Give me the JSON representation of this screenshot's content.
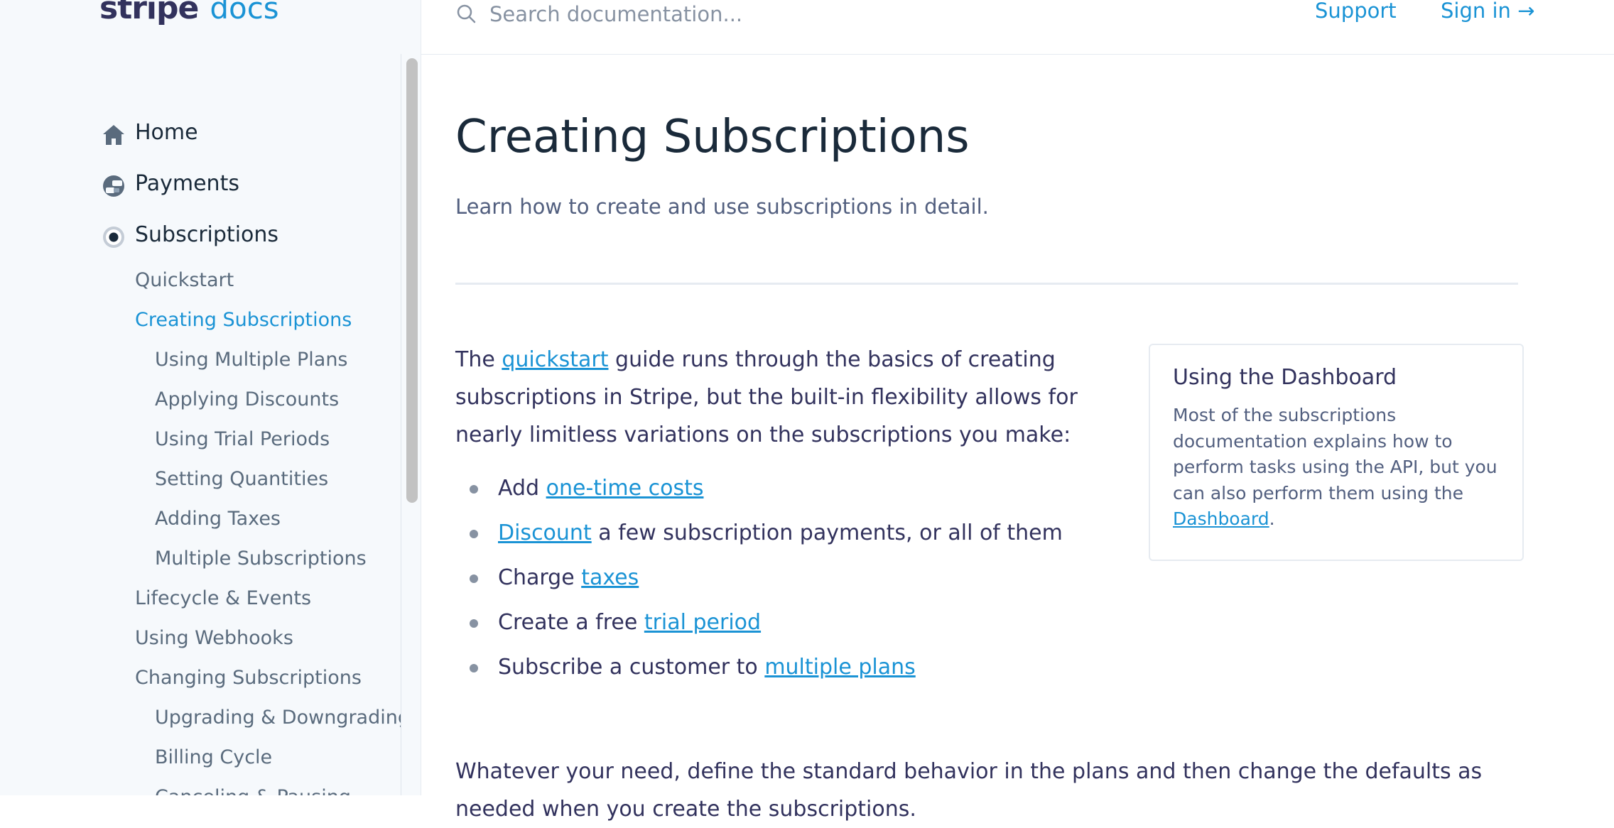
{
  "logo": {
    "brand": "stripe",
    "suffix": "docs"
  },
  "header": {
    "search_placeholder": "Search documentation...",
    "support_label": "Support",
    "signin_label": "Sign in →"
  },
  "sidebar": {
    "top_items": [
      {
        "label": "Home",
        "icon": "home-icon"
      },
      {
        "label": "Payments",
        "icon": "payments-icon"
      },
      {
        "label": "Subscriptions",
        "icon": "subscriptions-icon"
      }
    ],
    "sub_items": [
      {
        "label": "Quickstart",
        "level": 1
      },
      {
        "label": "Creating Subscriptions",
        "level": 1,
        "active": true
      },
      {
        "label": "Using Multiple Plans",
        "level": 2
      },
      {
        "label": "Applying Discounts",
        "level": 2
      },
      {
        "label": "Using Trial Periods",
        "level": 2
      },
      {
        "label": "Setting Quantities",
        "level": 2
      },
      {
        "label": "Adding Taxes",
        "level": 2
      },
      {
        "label": "Multiple Subscriptions",
        "level": 2
      },
      {
        "label": "Lifecycle & Events",
        "level": 1
      },
      {
        "label": "Using Webhooks",
        "level": 1
      },
      {
        "label": "Changing Subscriptions",
        "level": 1
      },
      {
        "label": "Upgrading & Downgrading",
        "level": 2
      },
      {
        "label": "Billing Cycle",
        "level": 2
      },
      {
        "label": "Canceling & Pausing",
        "level": 2
      }
    ]
  },
  "main": {
    "title": "Creating Subscriptions",
    "subtitle": "Learn how to create and use subscriptions in detail.",
    "intro": {
      "pre": "The ",
      "link": "quickstart",
      "post": " guide runs through the basics of creating subscriptions in Stripe, but the built-in flexibility allows for nearly limitless variations on the subscriptions you make:"
    },
    "bullets": [
      {
        "pre": "Add ",
        "link": "one-time costs",
        "post": ""
      },
      {
        "pre": "",
        "link": "Discount",
        "post": " a few subscription payments, or all of them"
      },
      {
        "pre": "Charge ",
        "link": "taxes",
        "post": ""
      },
      {
        "pre": "Create a free ",
        "link": "trial period",
        "post": ""
      },
      {
        "pre": "Subscribe a customer to ",
        "link": "multiple plans",
        "post": ""
      }
    ],
    "outro": "Whatever your need, define the standard behavior in the plans and then change the defaults as needed when you create the subscriptions.",
    "callout": {
      "title": "Using the Dashboard",
      "body": "Most of the subscriptions documentation explains how to perform tasks using the API, but you can also perform them using the ",
      "link": "Dashboard",
      "end": "."
    }
  },
  "colors": {
    "accent": "#1a93d5",
    "text": "#32325d",
    "sidebar_bg": "#f6f9fc"
  }
}
